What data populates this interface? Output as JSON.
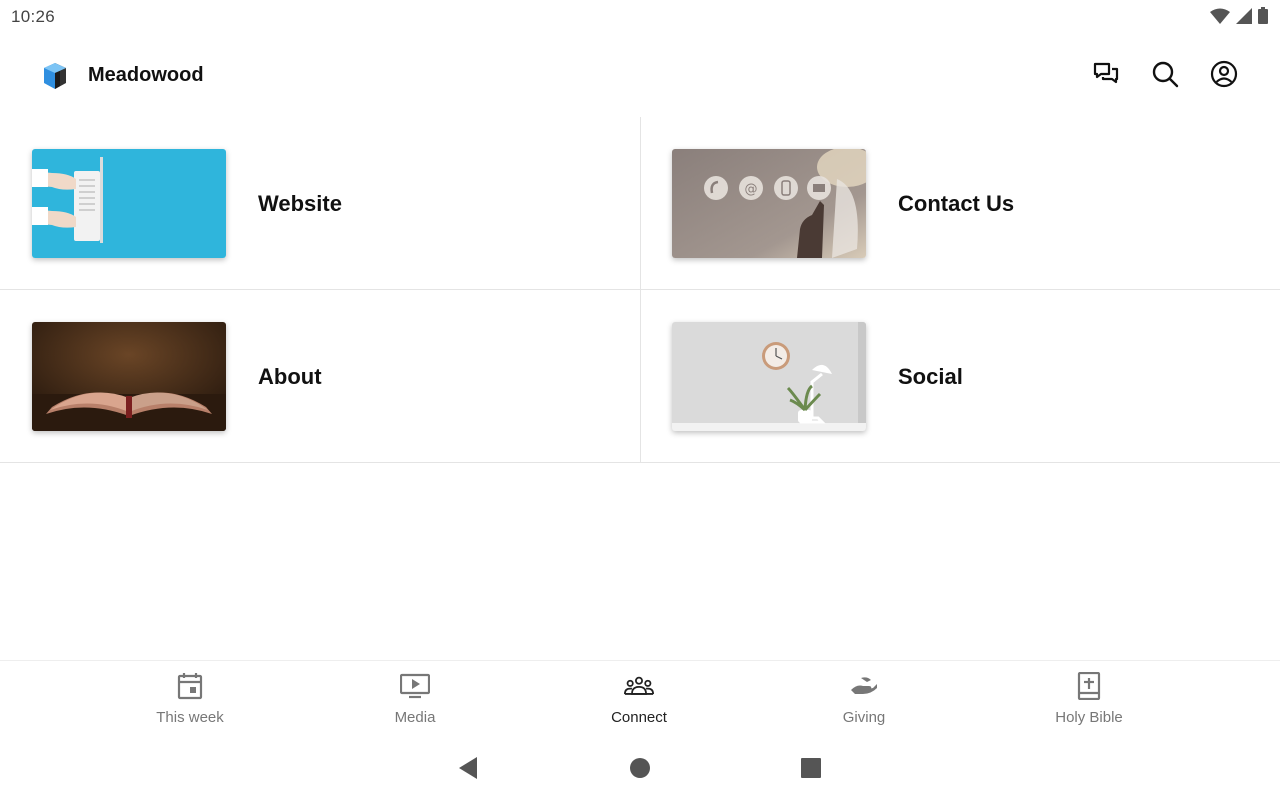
{
  "status_bar": {
    "time": "10:26",
    "icons": [
      "wifi-icon",
      "signal-icon",
      "battery-icon"
    ]
  },
  "app_bar": {
    "title": "Meadowood",
    "actions": [
      "messages-icon",
      "search-icon",
      "account-icon"
    ]
  },
  "tiles": [
    {
      "label": "Website",
      "image": "laptop-typing-image"
    },
    {
      "label": "Contact Us",
      "image": "contact-icons-image"
    },
    {
      "label": "About",
      "image": "open-bible-image"
    },
    {
      "label": "Social",
      "image": "desk-clock-plant-image"
    }
  ],
  "bottom_nav": {
    "items": [
      {
        "label": "This week",
        "icon": "calendar-icon"
      },
      {
        "label": "Media",
        "icon": "video-play-icon"
      },
      {
        "label": "Connect",
        "icon": "people-group-icon"
      },
      {
        "label": "Giving",
        "icon": "giving-hand-icon"
      },
      {
        "label": "Holy Bible",
        "icon": "bible-icon"
      }
    ],
    "active": "Connect"
  },
  "system_nav": [
    "back-icon",
    "home-icon",
    "recents-icon"
  ],
  "colors": {
    "accent_blue": "#2f8fe0",
    "active_text": "#222222",
    "inactive_text": "#777777",
    "divider": "#e4e4e4"
  }
}
